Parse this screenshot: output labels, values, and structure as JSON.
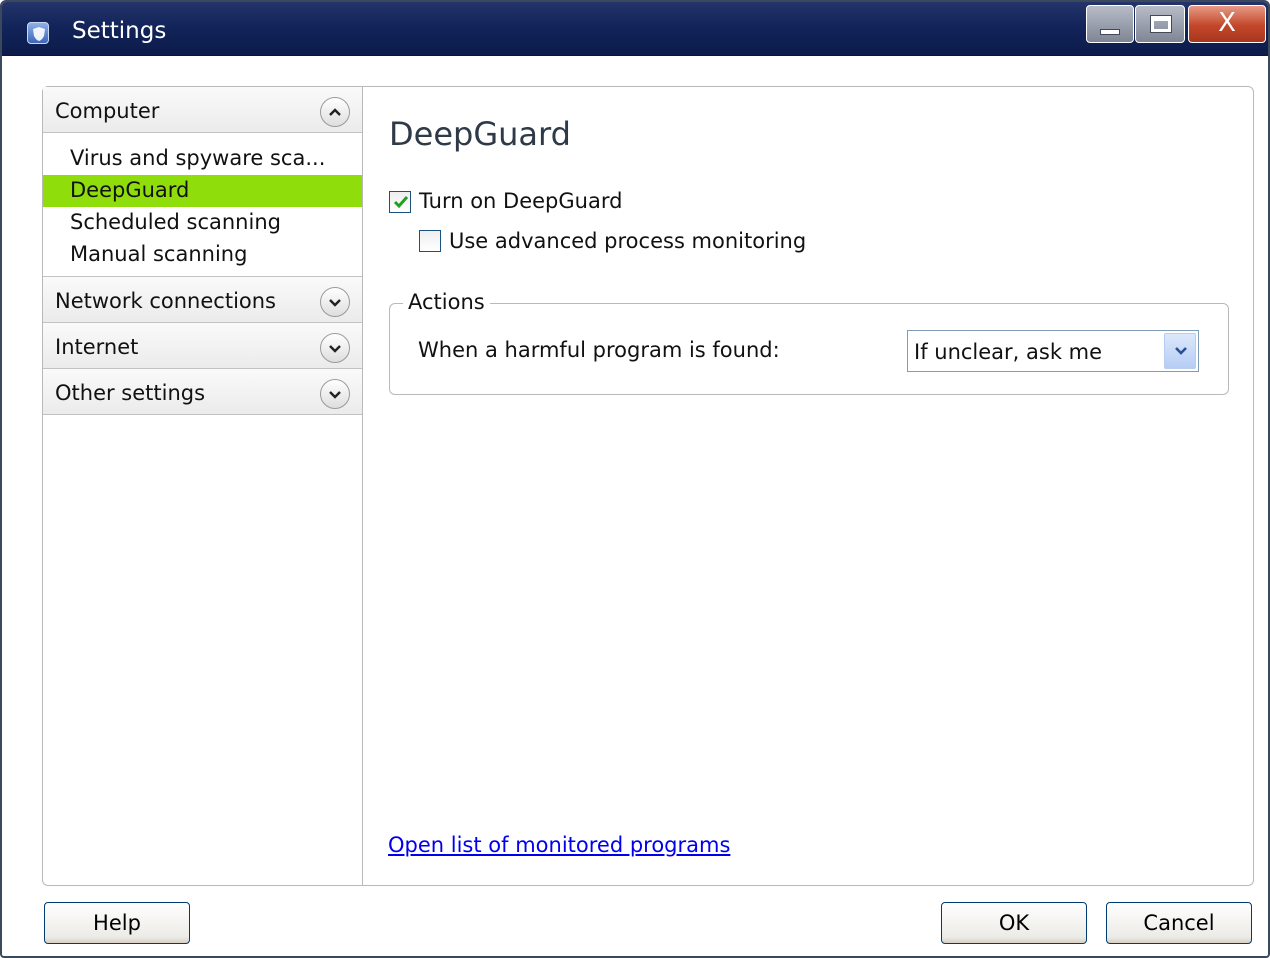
{
  "window": {
    "title": "Settings",
    "close_glyph": "X"
  },
  "sidebar": {
    "categories": [
      {
        "label": "Computer",
        "expanded": true,
        "items": [
          {
            "label": "Virus and spyware sca..."
          },
          {
            "label": "DeepGuard",
            "selected": true
          },
          {
            "label": "Scheduled scanning"
          },
          {
            "label": "Manual scanning"
          }
        ]
      },
      {
        "label": "Network connections",
        "expanded": false
      },
      {
        "label": "Internet",
        "expanded": false
      },
      {
        "label": "Other settings",
        "expanded": false
      }
    ],
    "selected_color": "#8fde0c"
  },
  "main": {
    "title": "DeepGuard",
    "turn_on": {
      "label": "Turn on DeepGuard",
      "checked": true
    },
    "advanced": {
      "label": "Use advanced process monitoring",
      "checked": false
    },
    "actions": {
      "legend": "Actions",
      "label": "When a harmful program is found:",
      "select_value": "If unclear, ask me"
    },
    "link": "Open list of monitored programs"
  },
  "buttons": {
    "help": "Help",
    "ok": "OK",
    "cancel": "Cancel"
  },
  "icons": [
    "app-shield-icon",
    "minimize-icon",
    "maximize-icon",
    "close-icon",
    "chevron-up-icon",
    "chevron-down-icon",
    "checkmark-icon",
    "dropdown-arrow-icon"
  ]
}
